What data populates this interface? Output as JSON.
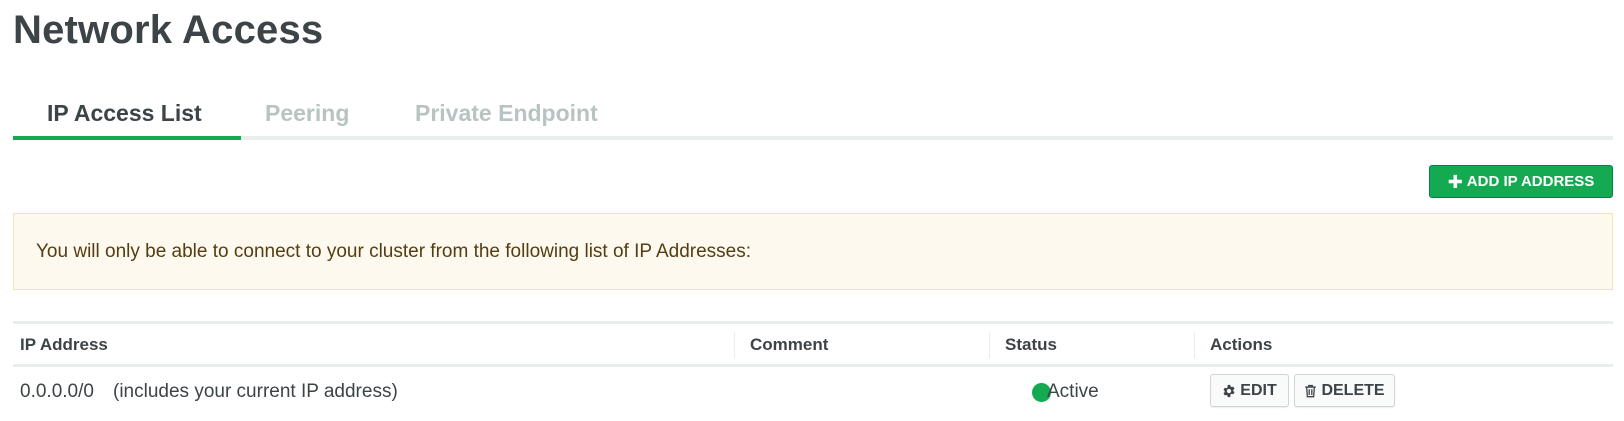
{
  "page": {
    "title": "Network Access"
  },
  "tabs": [
    {
      "label": "IP Access List",
      "active": true
    },
    {
      "label": "Peering",
      "active": false
    },
    {
      "label": "Private Endpoint",
      "active": false
    }
  ],
  "toolbar": {
    "add_button_label": "ADD IP ADDRESS",
    "add_button_icon": "plus-icon"
  },
  "banner": {
    "text": "You will only be able to connect to your cluster from the following list of IP Addresses:"
  },
  "table": {
    "columns": [
      "IP Address",
      "Comment",
      "Status",
      "Actions"
    ],
    "rows": [
      {
        "ip_address": "0.0.0.0/0",
        "ip_note": "(includes your current IP address)",
        "comment": "",
        "status": "Active",
        "status_color": "#13aa52",
        "actions": {
          "edit_label": "EDIT",
          "edit_icon": "gear-icon",
          "delete_label": "DELETE",
          "delete_icon": "trash-icon"
        }
      }
    ]
  },
  "colors": {
    "accent": "#13aa52",
    "banner_bg": "#fef9ee",
    "banner_text": "#543d11"
  }
}
